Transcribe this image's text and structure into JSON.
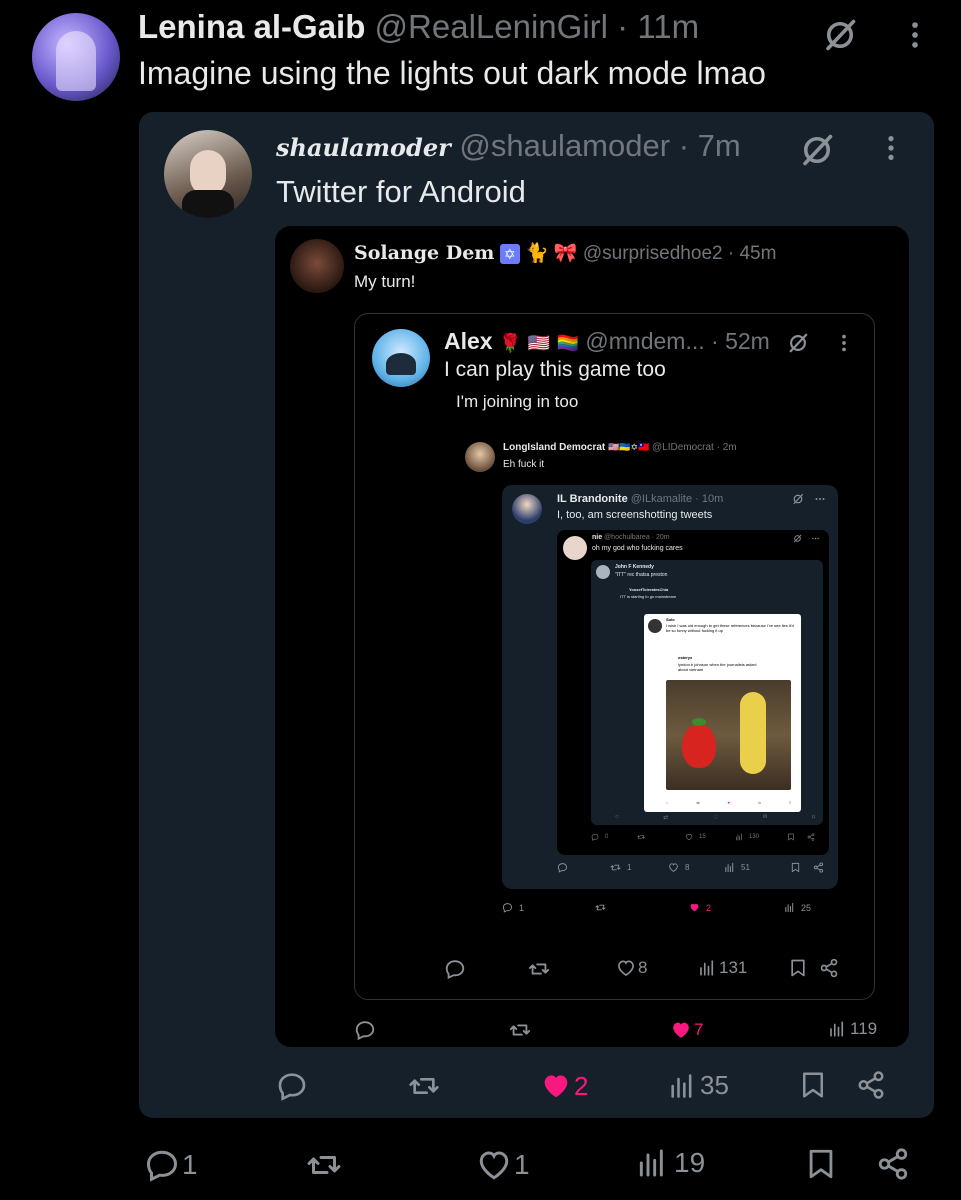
{
  "tweet": {
    "name": "Lenina al-Gaib",
    "handle": "@RealLeninGirl",
    "sep": "·",
    "time": "11m",
    "text": "Imagine using the lights out dark mode lmao",
    "actions": {
      "replies": "1",
      "likes": "1",
      "views": "19"
    }
  },
  "q1": {
    "name": "shaulamoder",
    "handle": "@shaulamoder",
    "sep": "·",
    "time": "7m",
    "text": "Twitter for Android",
    "actions": {
      "likes": "2",
      "views": "35"
    }
  },
  "q2": {
    "name": "Solange Dem",
    "handle": "@surprisedhoe2",
    "sep": "·",
    "time": "45m",
    "text": "My turn!",
    "actions": {
      "likes": "7",
      "views": "119"
    }
  },
  "q3": {
    "name": "Alex",
    "handle": "@mndem...",
    "sep": "·",
    "time": "52m",
    "text": "I can play this game too",
    "subtext": "I'm joining in too",
    "actions": {
      "likes": "8",
      "views": "131"
    }
  },
  "q4": {
    "name": "LongIsland Democrat",
    "handle": "@LIDemocrat",
    "time": "2m",
    "text": "Eh fuck it",
    "actions": {
      "replies": "1",
      "likes": "2",
      "views": "25"
    }
  },
  "q5": {
    "name": "IL Brandonite",
    "handle": "@ILkamalite",
    "time": "10m",
    "text": "I, too, am screenshotting tweets",
    "actions": {
      "retweets": "1",
      "likes": "8",
      "views": "51"
    }
  },
  "q6": {
    "name": "nie",
    "handle": "@hochulbarea",
    "time": "20m",
    "text": "oh my god who fucking cares",
    "actions": {
      "replies": "0",
      "likes": "15",
      "views": "130"
    }
  },
  "q7": {
    "name": "John F Kennedy",
    "text": "\"ITT\" rec thatsa preston"
  },
  "q8": {
    "name": "YousefToleratesChia",
    "text": "ITT is starting to go mainstream"
  },
  "q9": {
    "name": "Solo",
    "text": "I wish I was old enough to get these references because I've see lies it'd be so funny without fucking it up"
  },
  "q10": {
    "name": "osteryx",
    "text": "lyndon b johnson when the journalists asked about vietnam"
  },
  "colors": {
    "bg": "#000000",
    "card": "#15202b",
    "like": "#f91880",
    "muted": "#71767b",
    "text": "#e7e9ea"
  },
  "icons": [
    "reply-icon",
    "retweet-icon",
    "heart-icon",
    "views-icon",
    "bookmark-icon",
    "share-icon",
    "grok-icon",
    "more-icon"
  ]
}
